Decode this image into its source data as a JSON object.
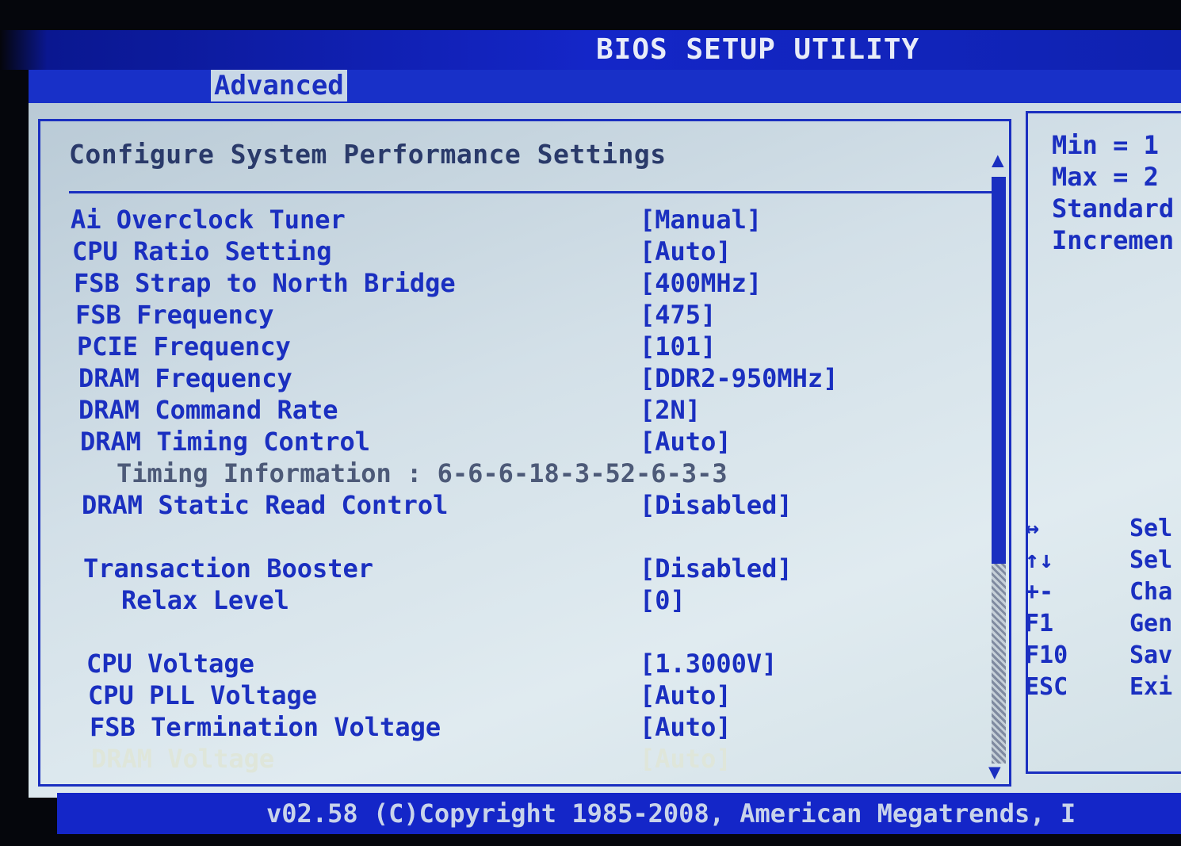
{
  "window": {
    "title": "BIOS SETUP UTILITY"
  },
  "tabs": [
    {
      "label": "Advanced",
      "active": true
    }
  ],
  "main": {
    "heading": "Configure System Performance Settings",
    "settings": [
      {
        "label": "Ai Overclock Tuner",
        "value": "[Manual]"
      },
      {
        "label": "CPU Ratio Setting",
        "value": "[Auto]"
      },
      {
        "label": "FSB Strap to North Bridge",
        "value": "[400MHz]"
      },
      {
        "label": "FSB Frequency",
        "value": "[475]"
      },
      {
        "label": "PCIE Frequency",
        "value": "[101]"
      },
      {
        "label": "DRAM Frequency",
        "value": "[DDR2-950MHz]"
      },
      {
        "label": "DRAM Command Rate",
        "value": "[2N]"
      },
      {
        "label": "DRAM Timing Control",
        "value": "[Auto]"
      },
      {
        "label": "Timing Information : 6-6-6-18-3-52-6-3-3",
        "value": ""
      },
      {
        "label": "DRAM Static Read Control",
        "value": "[Disabled]"
      },
      {
        "label": "Transaction Booster",
        "value": "[Disabled]"
      },
      {
        "label": "Relax Level",
        "value": "[0]"
      },
      {
        "label": "CPU Voltage",
        "value": "[1.3000V]"
      },
      {
        "label": "CPU PLL Voltage",
        "value": "[Auto]"
      },
      {
        "label": "FSB Termination Voltage",
        "value": "[Auto]"
      },
      {
        "label": "DRAM Voltage",
        "value": "[Auto]"
      }
    ]
  },
  "side": {
    "info": [
      "Min = 1",
      "Max = 2",
      "Standard",
      "Incremen"
    ],
    "keys": [
      {
        "key": "↔",
        "desc": "Sel"
      },
      {
        "key": "↑↓",
        "desc": "Sel"
      },
      {
        "key": "+-",
        "desc": "Cha"
      },
      {
        "key": "F1",
        "desc": "Gen"
      },
      {
        "key": "F10",
        "desc": "Sav"
      },
      {
        "key": "ESC",
        "desc": "Exi"
      }
    ]
  },
  "footer": {
    "text": "v02.58 (C)Copyright 1985-2008, American Megatrends, I"
  },
  "colors": {
    "accent": "#1a2fc0",
    "background": "#d3e0e8",
    "highlight": "#dfe6da"
  }
}
